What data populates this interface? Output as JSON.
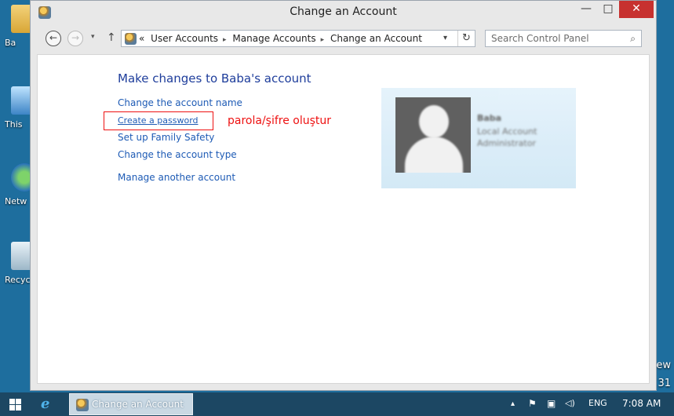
{
  "desktop": {
    "icons": [
      {
        "label": "Ba",
        "name": "folder-icon"
      },
      {
        "label": "This",
        "name": "computer-icon"
      },
      {
        "label": "Netw",
        "name": "network-icon"
      },
      {
        "label": "Recyc",
        "name": "recycle-bin-icon"
      }
    ],
    "right_text_1": "ew",
    "right_text_2": "31"
  },
  "window": {
    "title": "Change an Account",
    "minimize": "—",
    "maximize": "□",
    "close": "✕"
  },
  "nav": {
    "back": "←",
    "forward": "→",
    "recent": "▾",
    "up": "↑",
    "address_prefix": "«",
    "breadcrumbs": [
      "User Accounts",
      "Manage Accounts",
      "Change an Account"
    ],
    "crumb_sep": "▸",
    "dropdown": "▾",
    "refresh": "↻",
    "search_placeholder": "Search Control Panel",
    "search_icon": "⌕"
  },
  "content": {
    "heading": "Make changes to Baba's account",
    "links": {
      "change_name": "Change the account name",
      "create_password": "Create a password",
      "family_safety": "Set up Family Safety",
      "change_type": "Change the account type",
      "manage_another": "Manage another account"
    },
    "annotation": "parola/şifre oluştur",
    "account_tile": {
      "name": "Baba",
      "role_line1": "Local Account",
      "role_line2": "Administrator"
    }
  },
  "taskbar": {
    "task_label": "Change an Account",
    "ie_glyph": "e",
    "tray": {
      "up_arrow": "▴",
      "flag": "⚑",
      "network": "▣",
      "volume": "◁)",
      "language": "ENG",
      "clock": "7:08 AM"
    }
  },
  "colors": {
    "desktop": "#1e6e9e",
    "link": "#1e5bb5",
    "heading": "#1e3d9b",
    "annotation": "#ee1111",
    "close_button": "#c7312f",
    "taskbar": "#1c4763"
  }
}
